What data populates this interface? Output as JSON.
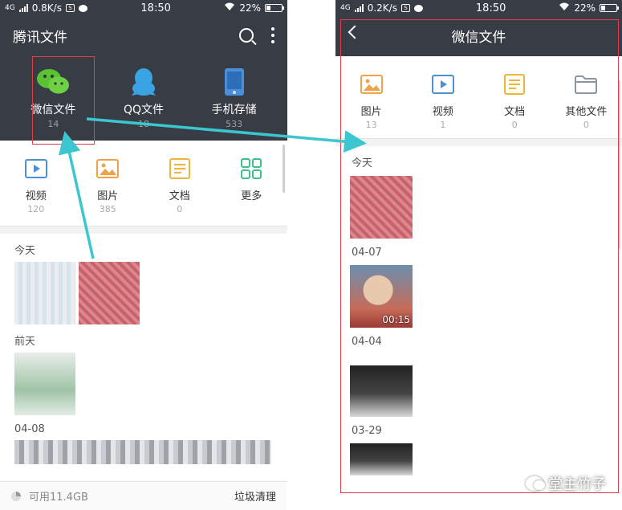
{
  "left": {
    "status": {
      "network": "4G",
      "speed": "0.8K/s",
      "time": "18:50",
      "battery": "22%"
    },
    "header": {
      "title": "腾讯文件"
    },
    "sources": [
      {
        "label": "微信文件",
        "count": "14",
        "icon": "wechat-icon"
      },
      {
        "label": "QQ文件",
        "count": "18",
        "icon": "qq-icon"
      },
      {
        "label": "手机存储",
        "count": "533",
        "icon": "phone-storage-icon"
      }
    ],
    "categories": [
      {
        "label": "视频",
        "count": "120",
        "icon": "video-icon"
      },
      {
        "label": "图片",
        "count": "385",
        "icon": "image-icon"
      },
      {
        "label": "文档",
        "count": "0",
        "icon": "document-icon"
      },
      {
        "label": "更多",
        "count": "",
        "icon": "grid-more-icon"
      }
    ],
    "sections": [
      "今天",
      "前天",
      "04-08"
    ],
    "footer": {
      "storage": "可用11.4GB",
      "clean": "垃圾清理"
    }
  },
  "right": {
    "status": {
      "network": "4G",
      "speed": "0.2K/s",
      "time": "18:50",
      "battery": "22%"
    },
    "header": {
      "title": "微信文件"
    },
    "categories": [
      {
        "label": "图片",
        "count": "13",
        "icon": "image-icon"
      },
      {
        "label": "视频",
        "count": "1",
        "icon": "video-icon"
      },
      {
        "label": "文档",
        "count": "0",
        "icon": "document-icon"
      },
      {
        "label": "其他文件",
        "count": "0",
        "icon": "folder-icon"
      }
    ],
    "sections": [
      "今天",
      "04-07",
      "04-04",
      "03-29"
    ],
    "video_duration": "00:15"
  },
  "watermark": {
    "text": "堂主竹子"
  },
  "colors": {
    "header_bg": "#383d45",
    "annotation_red": "#e0404a",
    "annotation_arrow": "#3cc6cf"
  }
}
